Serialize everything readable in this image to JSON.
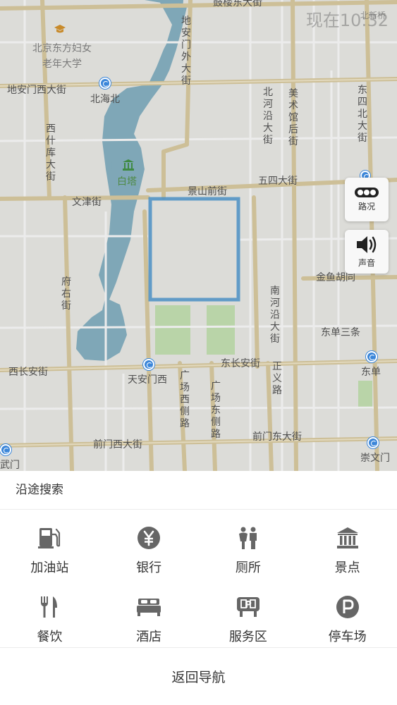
{
  "map": {
    "clock": "现在10:32",
    "clock_overlap": "北新桥",
    "labels": {
      "gulou": "鼓楼东大街",
      "women_univ": "北京东方妇女老年大学",
      "dianmen_outer": "地安门外大街",
      "dianmen_west": "地安门西大街",
      "beihaibei": "北海北",
      "xishiku": "西什库大街",
      "beiheyan": "北河沿大街",
      "meishuguan": "美术馆后街",
      "dongsi_north": "东四北大街",
      "baita": "白塔",
      "jingshan": "景山前街",
      "wusi": "五四大街",
      "wenjin": "文津街",
      "fuyou": "府右街",
      "nanheyan": "南河沿大街",
      "jinyu": "金鱼胡同",
      "dongdan_3": "东单三条",
      "xichangan": "西长安街",
      "tiananmen_west": "天安门西",
      "dongchangan": "东长安街",
      "zhengyi": "正义路",
      "dongdan": "东单",
      "guangchang_west": "广场西侧路",
      "guangchang_east": "广场东侧路",
      "qianmen_west": "前门西大街",
      "qianmen_east": "前门东大街",
      "chongwenmen": "崇文门",
      "wumen": "武门"
    },
    "buttons": {
      "traffic": "路况",
      "sound": "声音"
    }
  },
  "sheet": {
    "title": "沿途搜索",
    "categories": [
      {
        "label": "加油站",
        "icon": "gas-station-icon"
      },
      {
        "label": "银行",
        "icon": "bank-yen-icon"
      },
      {
        "label": "厕所",
        "icon": "toilet-icon"
      },
      {
        "label": "景点",
        "icon": "scenic-spot-icon"
      },
      {
        "label": "餐饮",
        "icon": "dining-icon"
      },
      {
        "label": "酒店",
        "icon": "hotel-bed-icon"
      },
      {
        "label": "服务区",
        "icon": "service-area-icon"
      },
      {
        "label": "停车场",
        "icon": "parking-icon"
      }
    ],
    "return_label": "返回导航"
  },
  "colors": {
    "map_bg": "#dcdcd8",
    "road_main": "#c9b98f",
    "road_minor": "#eeeeee",
    "water": "#7fa7b7",
    "park": "#b9d4a8",
    "palace_wall": "#4b8fc4",
    "icon_gray": "#666666",
    "metro_blue": "#3b86d9"
  }
}
